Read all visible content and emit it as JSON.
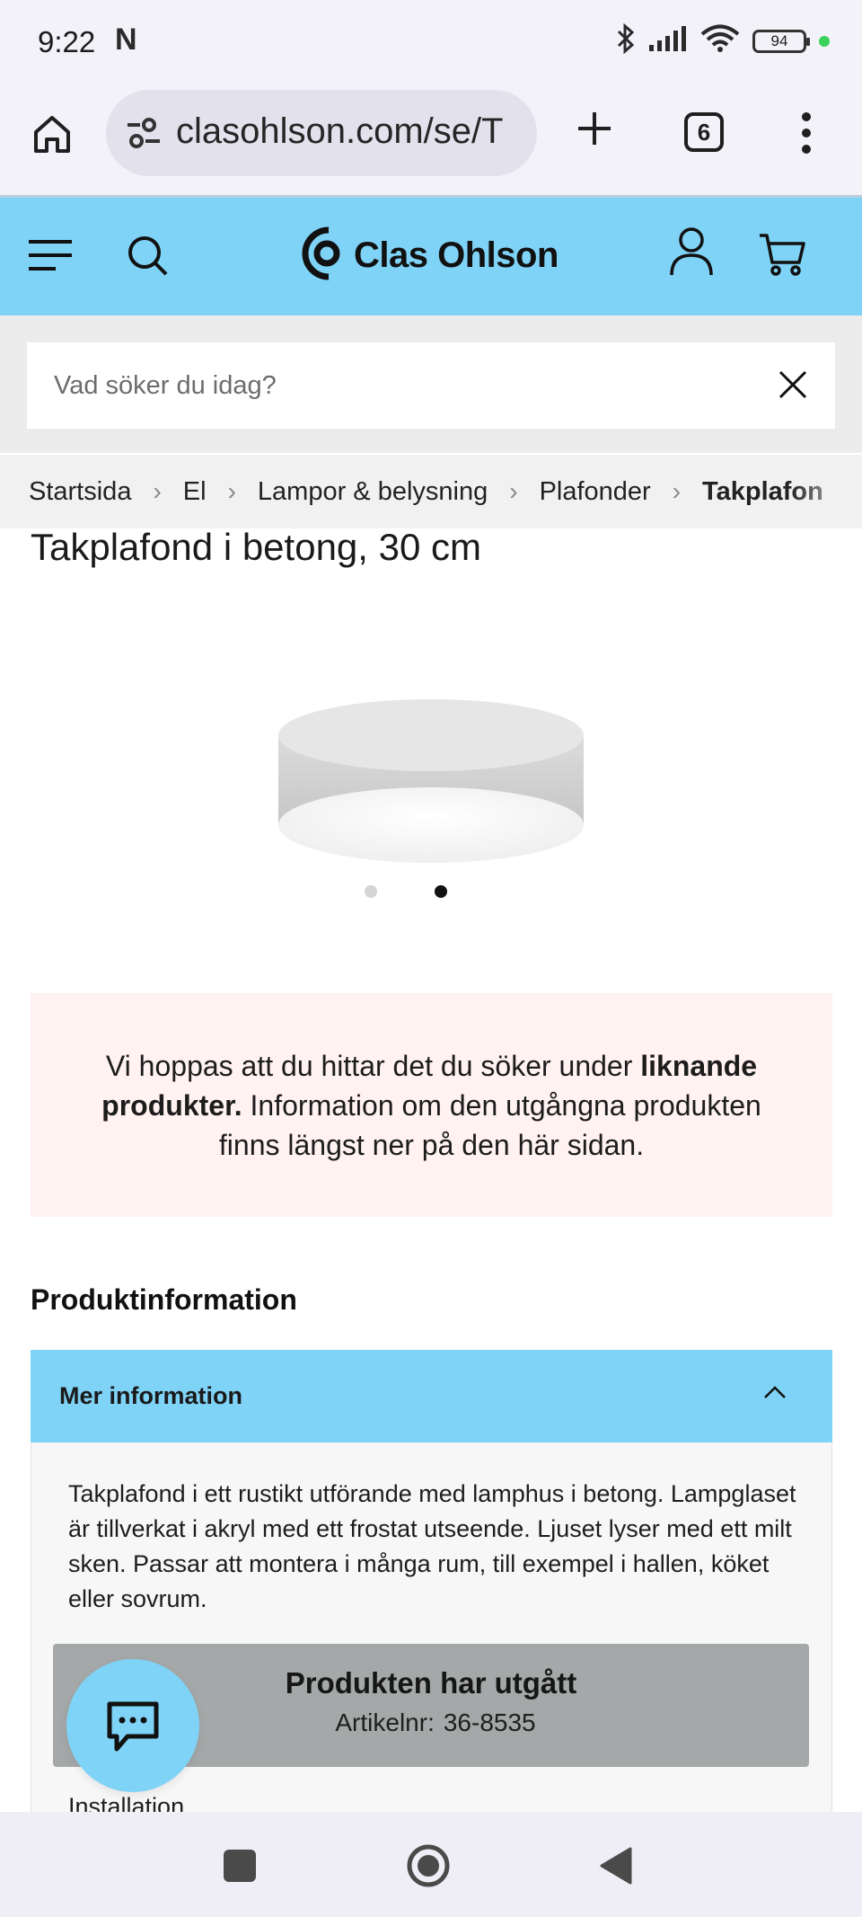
{
  "status_bar": {
    "time": "9:22",
    "notification_icon": "N",
    "battery": "94"
  },
  "browser": {
    "url": "clasohlson.com/se/T",
    "tab_count": "6"
  },
  "site": {
    "brand": "Clas Ohlson",
    "search_placeholder": "Vad söker du idag?"
  },
  "breadcrumb": [
    "Startsida",
    "El",
    "Lampor & belysning",
    "Plafonder",
    "Takplafon"
  ],
  "product": {
    "title": "Takplafond i betong, 30 cm",
    "carousel": {
      "count": 2,
      "active_index": 1
    }
  },
  "notice": {
    "text_before": "Vi hoppas att du hittar det du söker under",
    "bold": "liknande produkter.",
    "text_after": "Information om den utgångna produkten finns längst ner på den här sidan."
  },
  "product_info": {
    "heading": "Produktinformation",
    "accordion_label": "Mer information",
    "description": "Takplafond i ett rustikt utförande med lamphus i betong. Lampglaset är tillverkat i akryl med ett frostat utseende. Ljuset lyser med ett milt sken. Passar att montera i många rum, till exempel i hallen, köket eller sovrum.",
    "expired_title": "Produkten har utgått",
    "article_label": "Artikelnr:",
    "article_number": "36-8535",
    "next_section": "Installation"
  },
  "colors": {
    "accent": "#7fd3f7",
    "notice_bg": "#fff2f1",
    "expired_bg": "#a5a8a8"
  }
}
